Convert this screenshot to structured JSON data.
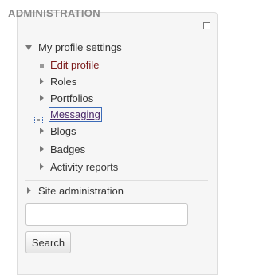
{
  "block": {
    "title": "ADMINISTRATION",
    "collapse_icon": "minus-box-icon"
  },
  "tree": {
    "my_profile_settings": "My profile settings",
    "edit_profile": "Edit profile",
    "roles": "Roles",
    "portfolios": "Portfolios",
    "messaging": "Messaging",
    "blogs": "Blogs",
    "badges": "Badges",
    "activity_reports": "Activity reports",
    "site_administration": "Site administration"
  },
  "search": {
    "value": "",
    "button_label": "Search"
  },
  "colors": {
    "link": "#7b1a1a",
    "focus_outline": "#3c6bb8",
    "header_text": "#8b8b8b"
  }
}
